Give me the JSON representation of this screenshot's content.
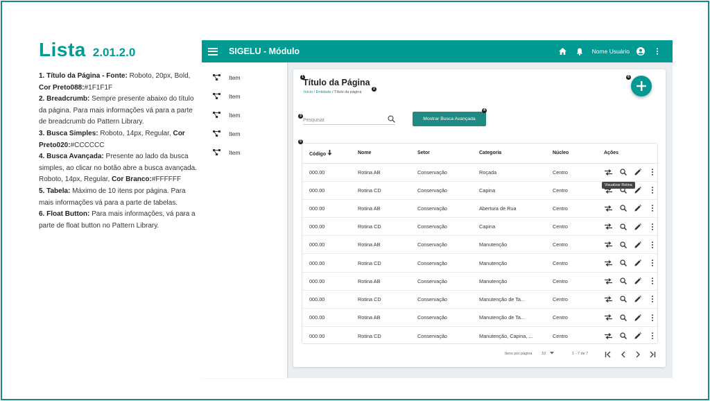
{
  "doc": {
    "title": "Lista",
    "version": "2.01.2.0",
    "items": [
      {
        "num": "1.",
        "head": "Título da Página - Fonte:",
        "text": " Roboto, 20px, Bold, ",
        "tail_bold": "Cor Preto088:",
        "tail": "#1F1F1F"
      },
      {
        "num": "2.",
        "head": "Breadcrumb:",
        "text": " Sempre presente abaixo do título da página. Para mais informações vá para a parte de breadcrumb do Pattern Library.",
        "tail_bold": "",
        "tail": ""
      },
      {
        "num": "3.",
        "head": "Busca Simples:",
        "text": " Roboto, 14px, Regular, ",
        "tail_bold": "Cor Preto020:",
        "tail": "#CCCCCC"
      },
      {
        "num": "4.",
        "head": "Busca Avançada:",
        "text": " Presente ao lado da busca simples, ao clicar no botão abre a busca avançada. Roboto, 14px, Regular, ",
        "tail_bold": "Cor Branco:",
        "tail": "#FFFFFF"
      },
      {
        "num": "5.",
        "head": "Tabela:",
        "text": " Máximo de 10 itens por página. Para mais informações vá para a parte de tabelas.",
        "tail_bold": "",
        "tail": ""
      },
      {
        "num": "6.",
        "head": "Float Button:",
        "text": " Para mais informações, vá para a parte de float button no Pattern Library.",
        "tail_bold": "",
        "tail": ""
      }
    ]
  },
  "app": {
    "brand": "SIGELU - Módulo",
    "user": "Nome Usuário",
    "colors": {
      "primary": "#009a93",
      "button": "#1e8a82"
    },
    "sidebar": {
      "items": [
        {
          "label": "Item"
        },
        {
          "label": "Item"
        },
        {
          "label": "Item"
        },
        {
          "label": "Item"
        },
        {
          "label": "Item"
        }
      ]
    },
    "page": {
      "title": "Título da Página",
      "breadcrumb": {
        "first": "Início",
        "sep": " / ",
        "second": "Entidade",
        "current": "Título da página"
      }
    },
    "markers": [
      "1",
      "2",
      "3",
      "4",
      "5",
      "6"
    ],
    "search": {
      "placeholder": "Pesquisar"
    },
    "advanced_button": "Mostrar Busca Avançada",
    "table": {
      "columns": [
        "Código",
        "Nome",
        "Setor",
        "Categoria",
        "Núcleo",
        "Ações"
      ],
      "rows": [
        {
          "codigo": "000.00",
          "nome": "Rotina AB",
          "setor": "Conservação",
          "categoria": "Roçada",
          "nucleo": "Centro"
        },
        {
          "codigo": "000.00",
          "nome": "Rotina CD",
          "setor": "Conservação",
          "categoria": "Capina",
          "nucleo": "Centro"
        },
        {
          "codigo": "000.00",
          "nome": "Rotina AB",
          "setor": "Conservação",
          "categoria": "Abertura de Rua",
          "nucleo": "Centro"
        },
        {
          "codigo": "000.00",
          "nome": "Rotina CD",
          "setor": "Conservação",
          "categoria": "Capina",
          "nucleo": "Centro"
        },
        {
          "codigo": "000.00",
          "nome": "Rotina AB",
          "setor": "Conservação",
          "categoria": "Manutenção",
          "nucleo": "Centro"
        },
        {
          "codigo": "000.00",
          "nome": "Rotina CD",
          "setor": "Conservação",
          "categoria": "Manutenção",
          "nucleo": "Centro"
        },
        {
          "codigo": "000.00",
          "nome": "Rotina AB",
          "setor": "Conservação",
          "categoria": "Manutenção",
          "nucleo": "Centro"
        },
        {
          "codigo": "000.00",
          "nome": "Rotina CD",
          "setor": "Conservação",
          "categoria": "Manutenção de Ta...",
          "nucleo": "Centro"
        },
        {
          "codigo": "000.00",
          "nome": "Rotina AB",
          "setor": "Conservação",
          "categoria": "Manutenção de Ta...",
          "nucleo": "Centro"
        },
        {
          "codigo": "000.00",
          "nome": "Rotina CD",
          "setor": "Conservação",
          "categoria": "Manutenção, Capina, ...",
          "nucleo": "Centro"
        }
      ],
      "row_actions": [
        "swap-icon",
        "search-icon",
        "edit-icon",
        "more-vert-icon"
      ]
    },
    "tooltip": "Visualizar Rotina",
    "paginator": {
      "items_per_page_label": "Itens por página",
      "page_size": "10",
      "range": "1 - 7 de 7"
    }
  }
}
